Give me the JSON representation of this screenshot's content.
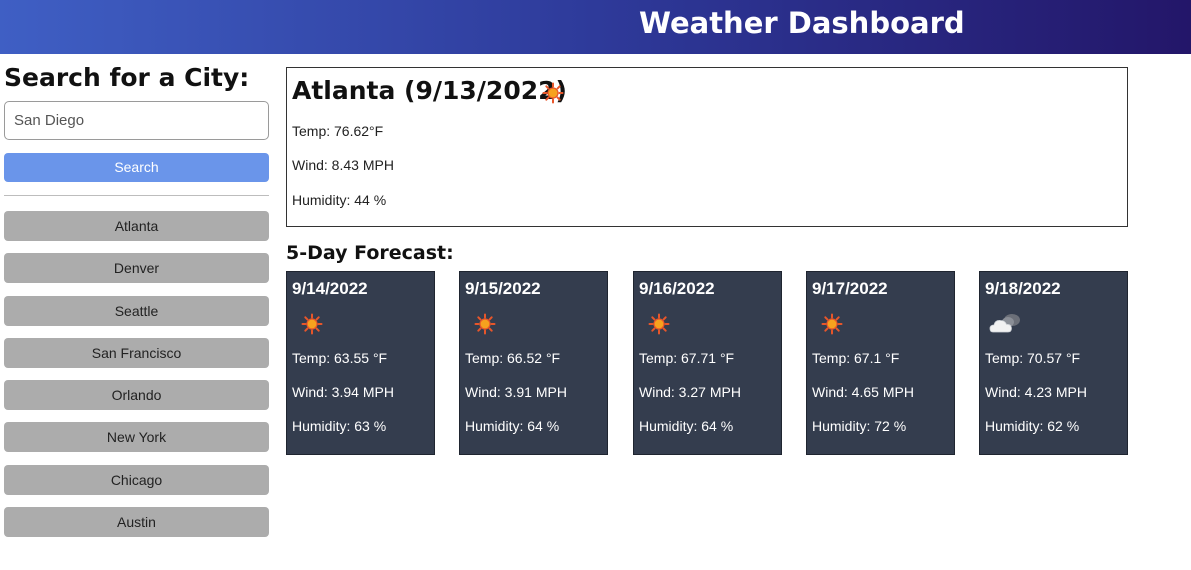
{
  "header": {
    "title": "Weather Dashboard"
  },
  "sidebar": {
    "search_title": "Search for a City:",
    "search_value": "San Diego",
    "search_button": "Search",
    "history": [
      "Atlanta",
      "Denver",
      "Seattle",
      "San Francisco",
      "Orlando",
      "New York",
      "Chicago",
      "Austin"
    ]
  },
  "current": {
    "title": "Atlanta (9/13/2022)",
    "icon": "sun-icon",
    "temp": "Temp: 76.62°F",
    "wind": "Wind: 8.43 MPH",
    "humidity": "Humidity: 44 %"
  },
  "forecast": {
    "heading": "5-Day Forecast:",
    "days": [
      {
        "date": "9/14/2022",
        "icon": "sun-icon",
        "temp": "Temp: 63.55 °F",
        "wind": "Wind: 3.94 MPH",
        "humidity": "Humidity: 63 %"
      },
      {
        "date": "9/15/2022",
        "icon": "sun-icon",
        "temp": "Temp: 66.52 °F",
        "wind": "Wind: 3.91 MPH",
        "humidity": "Humidity: 64 %"
      },
      {
        "date": "9/16/2022",
        "icon": "sun-icon",
        "temp": "Temp: 67.71 °F",
        "wind": "Wind: 3.27 MPH",
        "humidity": "Humidity: 64 %"
      },
      {
        "date": "9/17/2022",
        "icon": "sun-icon",
        "temp": "Temp: 67.1 °F",
        "wind": "Wind: 4.65 MPH",
        "humidity": "Humidity: 72 %"
      },
      {
        "date": "9/18/2022",
        "icon": "cloud-icon",
        "temp": "Temp: 70.57 °F",
        "wind": "Wind: 4.23 MPH",
        "humidity": "Humidity: 62 %"
      }
    ]
  },
  "colors": {
    "header_start": "#3f5fc4",
    "header_end": "#231669",
    "search_button": "#6a95ea",
    "history_button": "#acacac",
    "forecast_card": "#343d4e"
  }
}
